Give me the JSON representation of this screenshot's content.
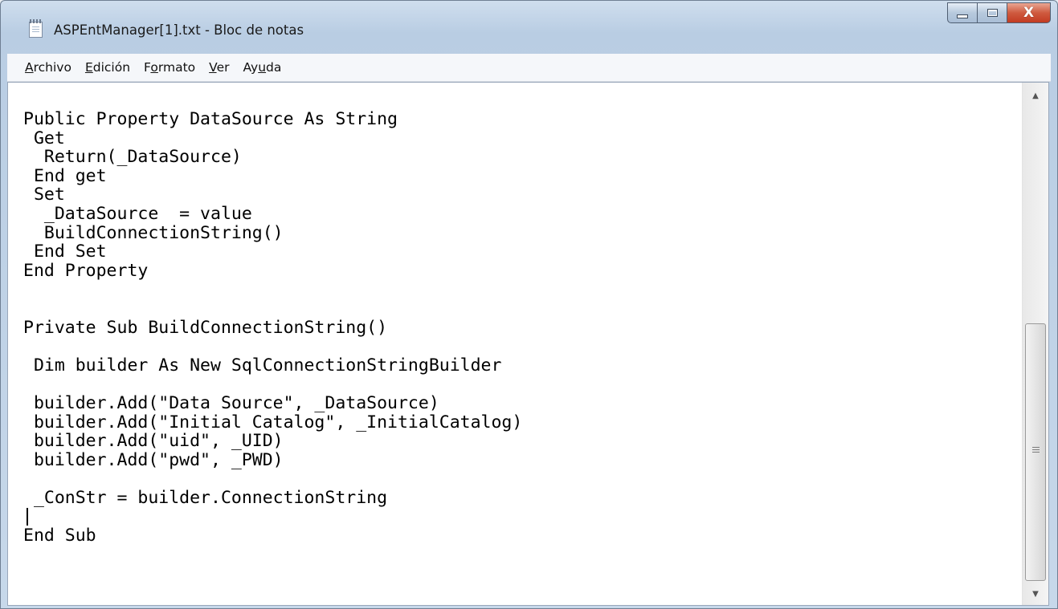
{
  "window": {
    "title": "ASPEntManager[1].txt - Bloc de notas",
    "icon": "notepad-icon",
    "controls": {
      "minimize_icon": "minimize-icon",
      "maximize_icon": "maximize-icon",
      "close_label": "X"
    }
  },
  "menu": {
    "items": [
      {
        "accel": "A",
        "rest": "rchivo",
        "pre": ""
      },
      {
        "accel": "E",
        "rest": "dición",
        "pre": ""
      },
      {
        "accel": "o",
        "rest": "rmato",
        "pre": "F"
      },
      {
        "accel": "V",
        "rest": "er",
        "pre": ""
      },
      {
        "accel": "u",
        "rest": "da",
        "pre": "Ay"
      }
    ]
  },
  "editor": {
    "lines": [
      "Public Property DataSource As String",
      " Get",
      "  Return(_DataSource)",
      " End get",
      " Set",
      "  _DataSource  = value",
      "  BuildConnectionString()",
      " End Set",
      "End Property",
      "",
      "",
      "Private Sub BuildConnectionString()",
      "",
      " Dim builder As New SqlConnectionStringBuilder",
      "",
      " builder.Add(\"Data Source\", _DataSource)",
      " builder.Add(\"Initial Catalog\", _InitialCatalog)",
      " builder.Add(\"uid\", _UID)",
      " builder.Add(\"pwd\", _PWD)",
      "",
      " _ConStr = builder.ConnectionString",
      "",
      "End Sub"
    ]
  },
  "scrollbar": {
    "up_icon": "scroll-up-arrow-icon",
    "down_icon": "scroll-down-arrow-icon",
    "position_fraction": 1.0
  }
}
